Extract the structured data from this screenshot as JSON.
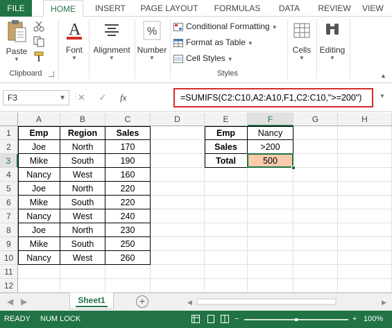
{
  "ribbon": {
    "tabs": [
      "FILE",
      "HOME",
      "INSERT",
      "PAGE LAYOUT",
      "FORMULAS",
      "DATA",
      "REVIEW",
      "VIEW"
    ],
    "active_tab": "HOME",
    "clipboard": {
      "paste": "Paste",
      "label": "Clipboard"
    },
    "font": {
      "label": "Font"
    },
    "alignment": {
      "label": "Alignment"
    },
    "number": {
      "label": "Number"
    },
    "styles": {
      "conditional": "Conditional Formatting",
      "format_table": "Format as Table",
      "cell_styles": "Cell Styles",
      "label": "Styles"
    },
    "cells": {
      "label": "Cells"
    },
    "editing": {
      "label": "Editing"
    }
  },
  "formula_bar": {
    "name_box": "F3",
    "fx": "fx",
    "formula": "=SUMIFS(C2:C10,A2:A10,F1,C2:C10,\">=200\")"
  },
  "columns": [
    "A",
    "B",
    "C",
    "D",
    "E",
    "F",
    "G",
    "H"
  ],
  "rows": [
    "1",
    "2",
    "3",
    "4",
    "5",
    "6",
    "7",
    "8",
    "9",
    "10",
    "11",
    "12"
  ],
  "table": {
    "headers": [
      "Emp",
      "Region",
      "Sales"
    ],
    "rows": [
      [
        "Joe",
        "North",
        "170"
      ],
      [
        "Mike",
        "South",
        "190"
      ],
      [
        "Nancy",
        "West",
        "160"
      ],
      [
        "Joe",
        "North",
        "220"
      ],
      [
        "Mike",
        "South",
        "220"
      ],
      [
        "Nancy",
        "West",
        "240"
      ],
      [
        "Joe",
        "North",
        "230"
      ],
      [
        "Mike",
        "South",
        "250"
      ],
      [
        "Nancy",
        "West",
        "260"
      ]
    ]
  },
  "criteria": {
    "rows": [
      [
        "Emp",
        "Nancy"
      ],
      [
        "Sales",
        ">200"
      ],
      [
        "Total",
        "500"
      ]
    ]
  },
  "sheets": {
    "active": "Sheet1"
  },
  "status": {
    "ready": "READY",
    "numlock": "NUM LOCK",
    "zoom": "100%"
  },
  "colors": {
    "accent": "#217346",
    "highlight": "#f8cbad",
    "formula_outline": "#d42b2b"
  }
}
